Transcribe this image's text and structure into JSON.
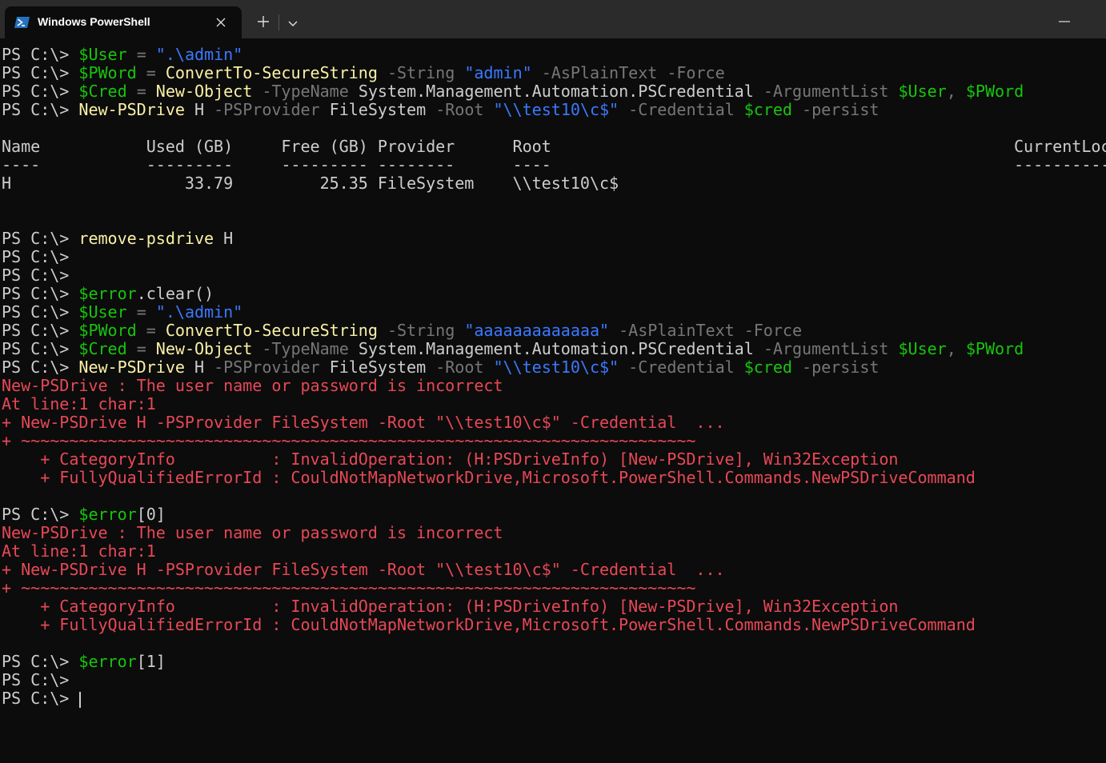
{
  "window": {
    "tab_title": "Windows PowerShell",
    "new_tab_glyph": "+",
    "dropdown_glyph": "⌄",
    "close_glyph": "✕",
    "minimize_glyph": "—",
    "icons": [
      "powershell-icon",
      "close-icon",
      "plus-icon",
      "chevron-down-icon",
      "minimize-icon"
    ]
  },
  "colors": {
    "background": "#0c0c0c",
    "default_text": "#cccccc",
    "command": "#f9f1a5",
    "variable": "#16c60c",
    "string": "#3b78ff",
    "parameter": "#767676",
    "error": "#e74856"
  },
  "lines": [
    [
      {
        "t": "PS C:\\> ",
        "c": "d"
      },
      {
        "t": "$User",
        "c": "g"
      },
      {
        "t": " = ",
        "c": "m"
      },
      {
        "t": "\".\\admin\"",
        "c": "c"
      }
    ],
    [
      {
        "t": "PS C:\\> ",
        "c": "d"
      },
      {
        "t": "$PWord",
        "c": "g"
      },
      {
        "t": " = ",
        "c": "m"
      },
      {
        "t": "ConvertTo-SecureString",
        "c": "y"
      },
      {
        "t": " -String ",
        "c": "m"
      },
      {
        "t": "\"admin\"",
        "c": "c"
      },
      {
        "t": " -AsPlainText -Force",
        "c": "m"
      }
    ],
    [
      {
        "t": "PS C:\\> ",
        "c": "d"
      },
      {
        "t": "$Cred",
        "c": "g"
      },
      {
        "t": " = ",
        "c": "m"
      },
      {
        "t": "New-Object",
        "c": "y"
      },
      {
        "t": " -TypeName ",
        "c": "m"
      },
      {
        "t": "System.Management.Automation.PSCredential",
        "c": "w"
      },
      {
        "t": " -ArgumentList ",
        "c": "m"
      },
      {
        "t": "$User",
        "c": "g"
      },
      {
        "t": ", ",
        "c": "m"
      },
      {
        "t": "$PWord",
        "c": "g"
      }
    ],
    [
      {
        "t": "PS C:\\> ",
        "c": "d"
      },
      {
        "t": "New-PSDrive",
        "c": "y"
      },
      {
        "t": " H ",
        "c": "w"
      },
      {
        "t": "-PSProvider ",
        "c": "m"
      },
      {
        "t": "FileSystem",
        "c": "w"
      },
      {
        "t": " -Root ",
        "c": "m"
      },
      {
        "t": "\"\\\\test10\\c$\"",
        "c": "c"
      },
      {
        "t": " -Credential ",
        "c": "m"
      },
      {
        "t": "$cred",
        "c": "g"
      },
      {
        "t": " -persist",
        "c": "m"
      }
    ],
    [
      {
        "t": "",
        "c": "d"
      }
    ],
    [
      {
        "t": "Name           Used (GB)     Free (GB) Provider      Root                                                CurrentLocation",
        "c": "d"
      }
    ],
    [
      {
        "t": "----           ---------     --------- --------      ----                                                ---------------",
        "c": "d"
      }
    ],
    [
      {
        "t": "H                  33.79         25.35 FileSystem    \\\\test10\\c$",
        "c": "d"
      }
    ],
    [
      {
        "t": "",
        "c": "d"
      }
    ],
    [
      {
        "t": "",
        "c": "d"
      }
    ],
    [
      {
        "t": "PS C:\\> ",
        "c": "d"
      },
      {
        "t": "remove-psdrive",
        "c": "y"
      },
      {
        "t": " H",
        "c": "w"
      }
    ],
    [
      {
        "t": "PS C:\\>",
        "c": "d"
      }
    ],
    [
      {
        "t": "PS C:\\>",
        "c": "d"
      }
    ],
    [
      {
        "t": "PS C:\\> ",
        "c": "d"
      },
      {
        "t": "$error",
        "c": "g"
      },
      {
        "t": ".clear()",
        "c": "w"
      }
    ],
    [
      {
        "t": "PS C:\\> ",
        "c": "d"
      },
      {
        "t": "$User",
        "c": "g"
      },
      {
        "t": " = ",
        "c": "m"
      },
      {
        "t": "\".\\admin\"",
        "c": "c"
      }
    ],
    [
      {
        "t": "PS C:\\> ",
        "c": "d"
      },
      {
        "t": "$PWord",
        "c": "g"
      },
      {
        "t": " = ",
        "c": "m"
      },
      {
        "t": "ConvertTo-SecureString",
        "c": "y"
      },
      {
        "t": " -String ",
        "c": "m"
      },
      {
        "t": "\"aaaaaaaaaaaaa\"",
        "c": "c"
      },
      {
        "t": " -AsPlainText -Force",
        "c": "m"
      }
    ],
    [
      {
        "t": "PS C:\\> ",
        "c": "d"
      },
      {
        "t": "$Cred",
        "c": "g"
      },
      {
        "t": " = ",
        "c": "m"
      },
      {
        "t": "New-Object",
        "c": "y"
      },
      {
        "t": " -TypeName ",
        "c": "m"
      },
      {
        "t": "System.Management.Automation.PSCredential",
        "c": "w"
      },
      {
        "t": " -ArgumentList ",
        "c": "m"
      },
      {
        "t": "$User",
        "c": "g"
      },
      {
        "t": ", ",
        "c": "m"
      },
      {
        "t": "$PWord",
        "c": "g"
      }
    ],
    [
      {
        "t": "PS C:\\> ",
        "c": "d"
      },
      {
        "t": "New-PSDrive",
        "c": "y"
      },
      {
        "t": " H ",
        "c": "w"
      },
      {
        "t": "-PSProvider ",
        "c": "m"
      },
      {
        "t": "FileSystem",
        "c": "w"
      },
      {
        "t": " -Root ",
        "c": "m"
      },
      {
        "t": "\"\\\\test10\\c$\"",
        "c": "c"
      },
      {
        "t": " -Credential ",
        "c": "m"
      },
      {
        "t": "$cred",
        "c": "g"
      },
      {
        "t": " -persist",
        "c": "m"
      }
    ],
    [
      {
        "t": "New-PSDrive : The user name or password is incorrect",
        "c": "r"
      }
    ],
    [
      {
        "t": "At line:1 char:1",
        "c": "r"
      }
    ],
    [
      {
        "t": "+ New-PSDrive H -PSProvider FileSystem -Root \"\\\\test10\\c$\" -Credential  ...",
        "c": "r"
      }
    ],
    [
      {
        "t": "+ ~~~~~~~~~~~~~~~~~~~~~~~~~~~~~~~~~~~~~~~~~~~~~~~~~~~~~~~~~~~~~~~~~~~~~~",
        "c": "r"
      }
    ],
    [
      {
        "t": "    + CategoryInfo          : InvalidOperation: (H:PSDriveInfo) [New-PSDrive], Win32Exception",
        "c": "r"
      }
    ],
    [
      {
        "t": "    + FullyQualifiedErrorId : CouldNotMapNetworkDrive,Microsoft.PowerShell.Commands.NewPSDriveCommand",
        "c": "r"
      }
    ],
    [
      {
        "t": "",
        "c": "d"
      }
    ],
    [
      {
        "t": "PS C:\\> ",
        "c": "d"
      },
      {
        "t": "$error",
        "c": "g"
      },
      {
        "t": "[0]",
        "c": "w"
      }
    ],
    [
      {
        "t": "New-PSDrive : The user name or password is incorrect",
        "c": "r"
      }
    ],
    [
      {
        "t": "At line:1 char:1",
        "c": "r"
      }
    ],
    [
      {
        "t": "+ New-PSDrive H -PSProvider FileSystem -Root \"\\\\test10\\c$\" -Credential  ...",
        "c": "r"
      }
    ],
    [
      {
        "t": "+ ~~~~~~~~~~~~~~~~~~~~~~~~~~~~~~~~~~~~~~~~~~~~~~~~~~~~~~~~~~~~~~~~~~~~~~",
        "c": "r"
      }
    ],
    [
      {
        "t": "    + CategoryInfo          : InvalidOperation: (H:PSDriveInfo) [New-PSDrive], Win32Exception",
        "c": "r"
      }
    ],
    [
      {
        "t": "    + FullyQualifiedErrorId : CouldNotMapNetworkDrive,Microsoft.PowerShell.Commands.NewPSDriveCommand",
        "c": "r"
      }
    ],
    [
      {
        "t": "",
        "c": "d"
      }
    ],
    [
      {
        "t": "PS C:\\> ",
        "c": "d"
      },
      {
        "t": "$error",
        "c": "g"
      },
      {
        "t": "[1]",
        "c": "w"
      }
    ],
    [
      {
        "t": "PS C:\\>",
        "c": "d"
      }
    ],
    [
      {
        "t": "PS C:\\> ",
        "c": "d"
      }
    ]
  ]
}
